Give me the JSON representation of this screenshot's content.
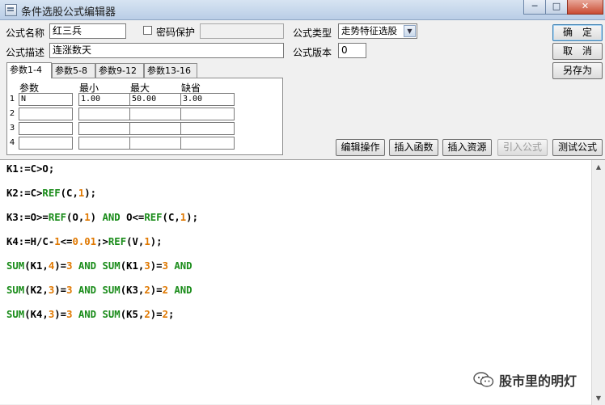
{
  "window": {
    "title": "条件选股公式编辑器",
    "minimize": "─",
    "maximize": "□",
    "close": "✕"
  },
  "form": {
    "name_label": "公式名称",
    "name_value": "红三兵",
    "password_label": "密码保护",
    "password_checked": false,
    "type_label": "公式类型",
    "type_value": "走势特征选股",
    "desc_label": "公式描述",
    "desc_value": "连涨数天",
    "version_label": "公式版本",
    "version_value": "0"
  },
  "buttons": {
    "ok": "确　定",
    "cancel": "取　消",
    "save_as": "另存为",
    "edit_op": "编辑操作",
    "insert_fn": "插入函数",
    "insert_res": "插入资源",
    "import_formula": "引入公式",
    "test_formula": "测试公式"
  },
  "tabs": [
    {
      "label": "参数1-4",
      "active": true
    },
    {
      "label": "参数5-8",
      "active": false
    },
    {
      "label": "参数9-12",
      "active": false
    },
    {
      "label": "参数13-16",
      "active": false
    }
  ],
  "params": {
    "headers": {
      "name": "参数",
      "min": "最小",
      "max": "最大",
      "default": "缺省"
    },
    "rows": [
      {
        "num": "1",
        "name": "N",
        "min": "1.00",
        "max": "50.00",
        "default": "3.00"
      },
      {
        "num": "2",
        "name": "",
        "min": "",
        "max": "",
        "default": ""
      },
      {
        "num": "3",
        "name": "",
        "min": "",
        "max": "",
        "default": ""
      },
      {
        "num": "4",
        "name": "",
        "min": "",
        "max": "",
        "default": ""
      }
    ]
  },
  "code": [
    [
      {
        "t": "K1:=C>O;",
        "c": "id"
      }
    ],
    [
      {
        "t": "K2:=C>",
        "c": "id"
      },
      {
        "t": "REF",
        "c": "fn"
      },
      {
        "t": "(C,",
        "c": "id"
      },
      {
        "t": "1",
        "c": "num"
      },
      {
        "t": ");",
        "c": "id"
      }
    ],
    [
      {
        "t": "K3:=O>=",
        "c": "id"
      },
      {
        "t": "REF",
        "c": "fn"
      },
      {
        "t": "(O,",
        "c": "id"
      },
      {
        "t": "1",
        "c": "num"
      },
      {
        "t": ") ",
        "c": "id"
      },
      {
        "t": "AND",
        "c": "fn"
      },
      {
        "t": " O<=",
        "c": "id"
      },
      {
        "t": "REF",
        "c": "fn"
      },
      {
        "t": "(C,",
        "c": "id"
      },
      {
        "t": "1",
        "c": "num"
      },
      {
        "t": ");",
        "c": "id"
      }
    ],
    [
      {
        "t": "K4:=H/C-",
        "c": "id"
      },
      {
        "t": "1",
        "c": "num"
      },
      {
        "t": "<=",
        "c": "id"
      },
      {
        "t": "0.01",
        "c": "num"
      },
      {
        "t": ";>",
        "c": "id"
      },
      {
        "t": "REF",
        "c": "fn"
      },
      {
        "t": "(V,",
        "c": "id"
      },
      {
        "t": "1",
        "c": "num"
      },
      {
        "t": ");",
        "c": "id"
      }
    ],
    [
      {
        "t": "SUM",
        "c": "fn"
      },
      {
        "t": "(K1,",
        "c": "id"
      },
      {
        "t": "4",
        "c": "num"
      },
      {
        "t": ")=",
        "c": "id"
      },
      {
        "t": "3",
        "c": "num"
      },
      {
        "t": " ",
        "c": "id"
      },
      {
        "t": "AND",
        "c": "fn"
      },
      {
        "t": " ",
        "c": "id"
      },
      {
        "t": "SUM",
        "c": "fn"
      },
      {
        "t": "(K1,",
        "c": "id"
      },
      {
        "t": "3",
        "c": "num"
      },
      {
        "t": ")=",
        "c": "id"
      },
      {
        "t": "3",
        "c": "num"
      },
      {
        "t": " ",
        "c": "id"
      },
      {
        "t": "AND",
        "c": "fn"
      }
    ],
    [
      {
        "t": "SUM",
        "c": "fn"
      },
      {
        "t": "(K2,",
        "c": "id"
      },
      {
        "t": "3",
        "c": "num"
      },
      {
        "t": ")=",
        "c": "id"
      },
      {
        "t": "3",
        "c": "num"
      },
      {
        "t": " ",
        "c": "id"
      },
      {
        "t": "AND",
        "c": "fn"
      },
      {
        "t": " ",
        "c": "id"
      },
      {
        "t": "SUM",
        "c": "fn"
      },
      {
        "t": "(K3,",
        "c": "id"
      },
      {
        "t": "2",
        "c": "num"
      },
      {
        "t": ")=",
        "c": "id"
      },
      {
        "t": "2",
        "c": "num"
      },
      {
        "t": " ",
        "c": "id"
      },
      {
        "t": "AND",
        "c": "fn"
      }
    ],
    [
      {
        "t": "SUM",
        "c": "fn"
      },
      {
        "t": "(K4,",
        "c": "id"
      },
      {
        "t": "3",
        "c": "num"
      },
      {
        "t": ")=",
        "c": "id"
      },
      {
        "t": "3",
        "c": "num"
      },
      {
        "t": " ",
        "c": "id"
      },
      {
        "t": "AND",
        "c": "fn"
      },
      {
        "t": " ",
        "c": "id"
      },
      {
        "t": "SUM",
        "c": "fn"
      },
      {
        "t": "(K5,",
        "c": "id"
      },
      {
        "t": "2",
        "c": "num"
      },
      {
        "t": ")=",
        "c": "id"
      },
      {
        "t": "2",
        "c": "num"
      },
      {
        "t": ";",
        "c": "id"
      }
    ]
  ],
  "watermark": "股市里的明灯",
  "icons": {
    "checkbox": "checkbox-icon",
    "dropdown": "chevron-down-icon",
    "watermark": "wechat-icon"
  }
}
